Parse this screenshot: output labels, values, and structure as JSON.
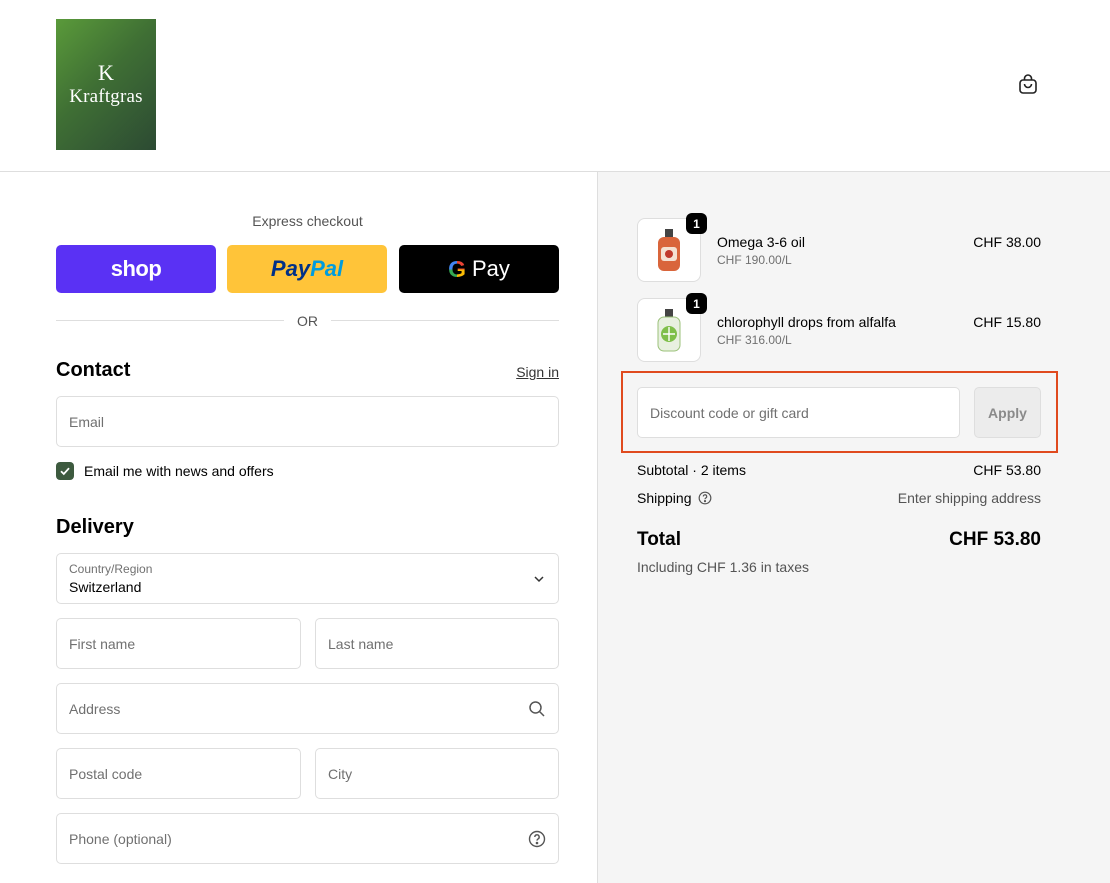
{
  "brand": {
    "logo_text": "Kraftgras",
    "logo_mark": "K"
  },
  "header": {
    "cart_icon": "shopping-bag-icon"
  },
  "express": {
    "label": "Express checkout",
    "shop_label": "shop",
    "paypal_label_1": "Pay",
    "paypal_label_2": "Pal",
    "gpay_g": "G",
    "gpay_label": "Pay",
    "or_label": "OR"
  },
  "contact": {
    "title": "Contact",
    "sign_in": "Sign in",
    "email_placeholder": "Email",
    "newsletter_label": "Email me with news and offers",
    "newsletter_checked": true
  },
  "delivery": {
    "title": "Delivery",
    "country_label": "Country/Region",
    "country_value": "Switzerland",
    "first_name_placeholder": "First name",
    "last_name_placeholder": "Last name",
    "address_placeholder": "Address",
    "postal_placeholder": "Postal code",
    "city_placeholder": "City",
    "phone_placeholder": "Phone (optional)"
  },
  "summary": {
    "items": [
      {
        "name": "Omega 3-6 oil",
        "unit_price": "CHF 190.00/L",
        "price": "CHF 38.00",
        "quantity": "1"
      },
      {
        "name": "chlorophyll drops from alfalfa",
        "unit_price": "CHF 316.00/L",
        "price": "CHF 15.80",
        "quantity": "1"
      }
    ],
    "discount_placeholder": "Discount code or gift card",
    "apply_label": "Apply",
    "subtotal_label": "Subtotal · 2 items",
    "subtotal_value": "CHF 53.80",
    "shipping_label": "Shipping",
    "shipping_value": "Enter shipping address",
    "total_label": "Total",
    "total_value": "CHF 53.80",
    "tax_note": "Including CHF 1.36 in taxes"
  },
  "colors": {
    "shop": "#5a31f4",
    "paypal": "#ffc439",
    "gpay": "#000000",
    "checkbox": "#3d5a3f",
    "highlight": "#e04a1e"
  }
}
